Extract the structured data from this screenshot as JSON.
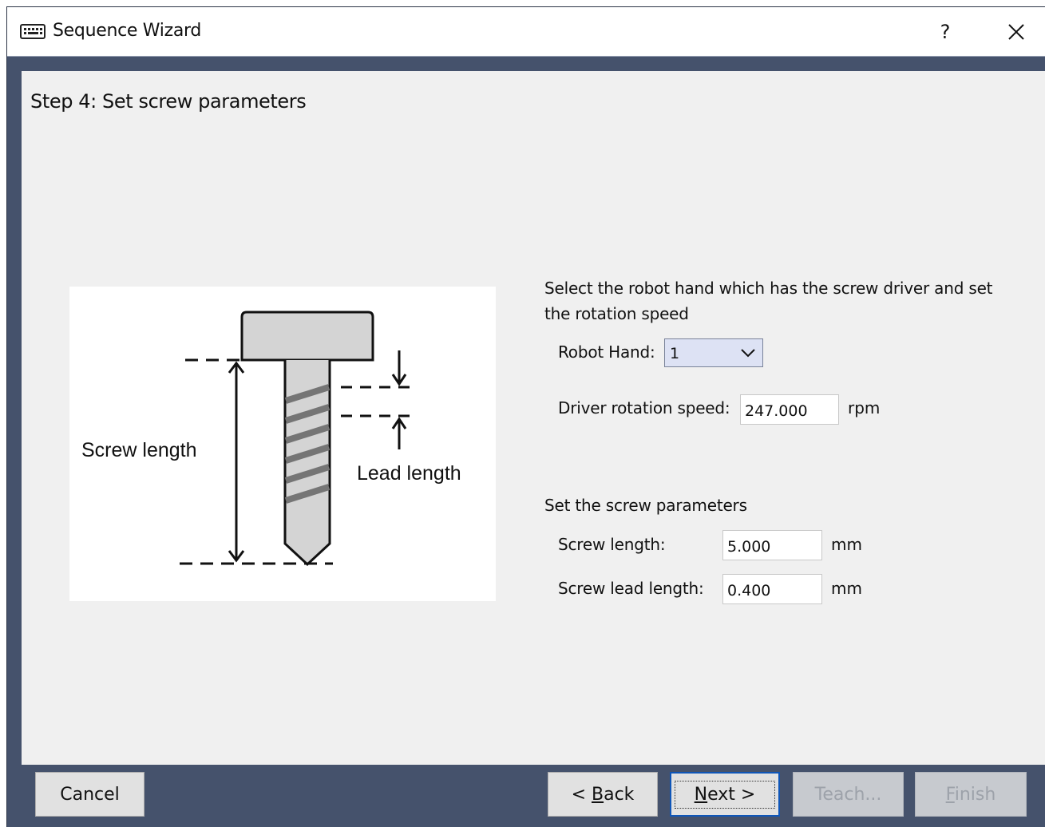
{
  "window": {
    "title": "Sequence Wizard",
    "help_label": "?"
  },
  "step": {
    "title": "Step 4: Set screw parameters"
  },
  "diagram": {
    "screw_length_label": "Screw length",
    "lead_length_label": "Lead length"
  },
  "hand_section": {
    "description": "Select the robot hand which has the screw driver and set the rotation speed",
    "robot_hand_label": "Robot Hand:",
    "robot_hand_value": "1",
    "speed_label": "Driver rotation speed:",
    "speed_value": "247.000",
    "speed_unit": "rpm"
  },
  "screw_section": {
    "description": "Set the screw parameters",
    "length_label": "Screw length:",
    "length_value": "5.000",
    "length_unit": "mm",
    "lead_label": "Screw lead length:",
    "lead_value": "0.400",
    "lead_unit": "mm"
  },
  "buttons": {
    "cancel": "Cancel",
    "back_prefix": "< ",
    "back_accel": "B",
    "back_rest": "ack",
    "next_accel": "N",
    "next_rest": "ext >",
    "teach": "Teach...",
    "finish_accel": "F",
    "finish_rest": "inish"
  },
  "colors": {
    "frame": "#45526c",
    "panel": "#f0f0f0",
    "select_bg": "#dde2f4",
    "default_button_border": "#0f56b8"
  },
  "icons": {
    "app": "keyboard-icon",
    "close": "close-icon",
    "dropdown": "chevron-down-icon"
  }
}
